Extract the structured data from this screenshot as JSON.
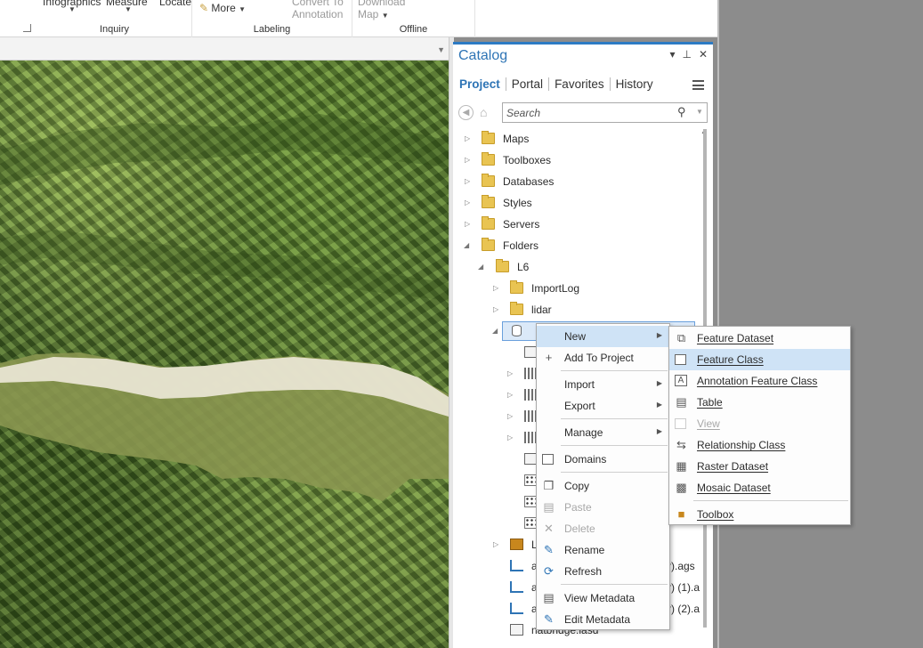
{
  "ribbon": {
    "inquiry_btn1": "Infographics",
    "inquiry_btn2": "Measure",
    "inquiry_btn3": "Locate",
    "inquiry_label": "Inquiry",
    "labeling_more": "More",
    "labeling_convert": "Convert To",
    "labeling_annotation": "Annotation",
    "labeling_label": "Labeling",
    "offline_download": "Download",
    "offline_map": "Map",
    "offline_label": "Offline"
  },
  "catalog": {
    "title": "Catalog",
    "pane_icons": [
      "▾",
      "⊥",
      "✕"
    ],
    "tabs": [
      "Project",
      "Portal",
      "Favorites",
      "History"
    ],
    "search_placeholder": "Search",
    "tree": {
      "maps": "Maps",
      "toolboxes": "Toolboxes",
      "databases": "Databases",
      "styles": "Styles",
      "servers": "Servers",
      "folders": "Folders",
      "l6": "L6",
      "importlog": "ImportLog",
      "lidar": "lidar",
      "trunc_l": "L",
      "ags1_suffix": "r).ags",
      "ags2_suffix": "r) (1).a",
      "ags3_suffix": "r) (2).a",
      "bottom_item": "natbridge.lasd",
      "trunc_a": "a"
    }
  },
  "context_menu": {
    "items": {
      "new": "New",
      "add_to_project": "Add To Project",
      "import": "Import",
      "export": "Export",
      "manage": "Manage",
      "domains": "Domains",
      "copy": "Copy",
      "paste": "Paste",
      "delete": "Delete",
      "rename": "Rename",
      "refresh": "Refresh",
      "view_metadata": "View Metadata",
      "edit_metadata": "Edit Metadata"
    }
  },
  "new_submenu": {
    "items": {
      "feature_dataset": "Feature Dataset",
      "feature_class": "Feature Class",
      "annotation_feature_class": "Annotation Feature Class",
      "table": "Table",
      "view": "View",
      "relationship_class": "Relationship Class",
      "raster_dataset": "Raster Dataset",
      "mosaic_dataset": "Mosaic Dataset",
      "toolbox": "Toolbox"
    }
  },
  "colors": {
    "accent": "#2e74b5",
    "highlight": "#cfe3f6",
    "folder": "#e9c452"
  }
}
